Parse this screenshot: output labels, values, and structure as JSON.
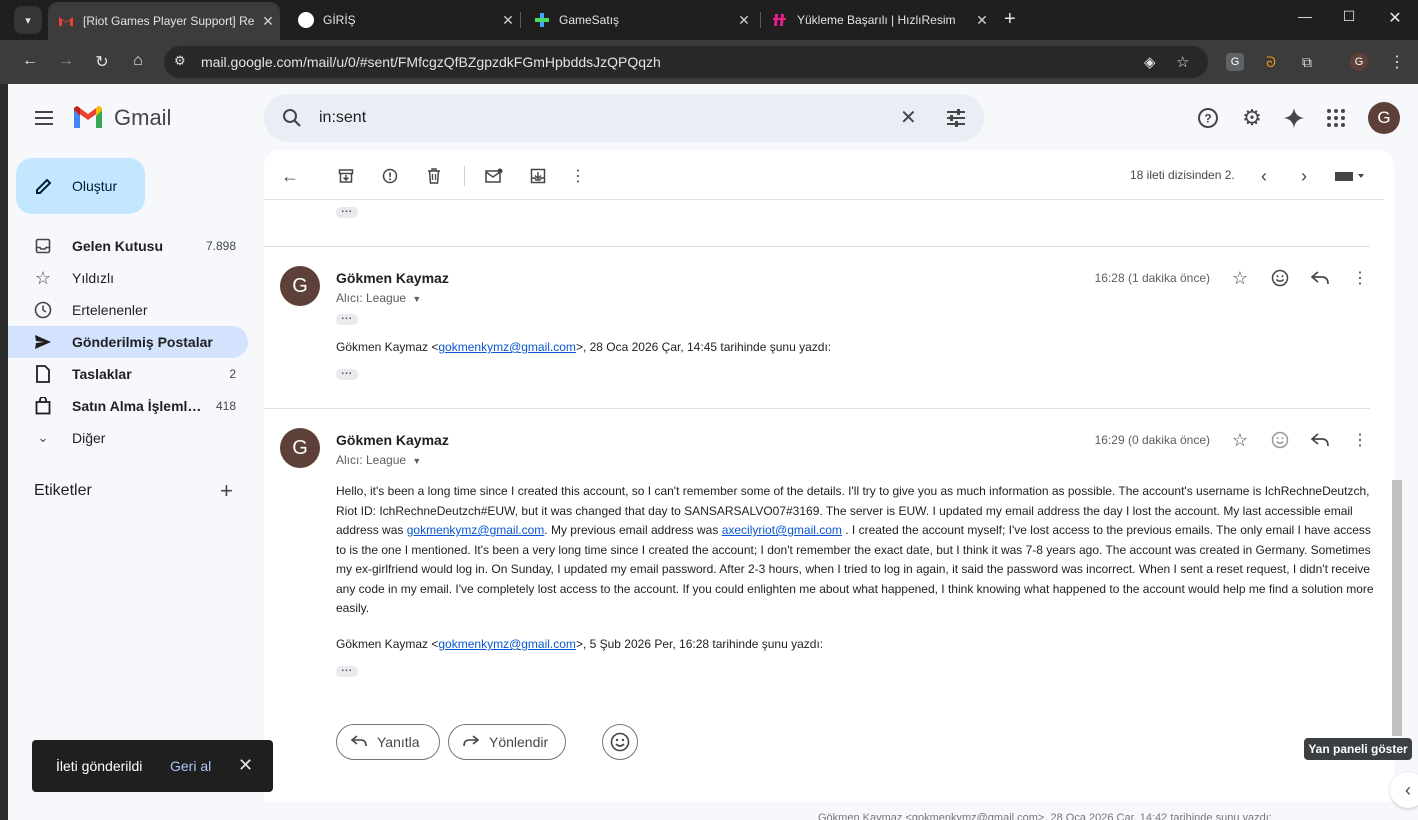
{
  "browser": {
    "tabs": [
      {
        "title": "[Riot Games Player Support] Re",
        "active": true
      },
      {
        "title": "GİRİŞ",
        "active": false
      },
      {
        "title": "GameSatış",
        "active": false
      },
      {
        "title": "Yükleme Başarılı | HızlıResim",
        "active": false
      }
    ],
    "url": "mail.google.com/mail/u/0/#sent/FMfcgzQfBZgpzdkFGmHpbddsJzQPQqzh"
  },
  "gmail": {
    "logo_text": "Gmail",
    "search_query": "in:sent",
    "avatar_letter": "G",
    "compose_label": "Oluştur",
    "nav": [
      {
        "label": "Gelen Kutusu",
        "count": "7.898",
        "icon": "inbox-icon"
      },
      {
        "label": "Yıldızlı",
        "count": "",
        "icon": "star-icon"
      },
      {
        "label": "Ertelenenler",
        "count": "",
        "icon": "clock-icon"
      },
      {
        "label": "Gönderilmiş Postalar",
        "count": "",
        "icon": "send-icon"
      },
      {
        "label": "Taslaklar",
        "count": "2",
        "icon": "draft-icon"
      },
      {
        "label": "Satın Alma İşlemleri",
        "count": "418",
        "icon": "bag-icon"
      },
      {
        "label": "Diğer",
        "count": "",
        "icon": "chevron-down-icon"
      }
    ],
    "labels_header": "Etiketler"
  },
  "toolbar": {
    "page_info": "18 ileti dizisinden 2."
  },
  "messages": [
    {
      "sender": "Gökmen Kaymaz",
      "to": "Alıcı: League",
      "time": "16:28 (1 dakika önce)",
      "quote_prefix": "Gökmen Kaymaz <",
      "quote_email": "gokmenkymz@gmail.com",
      "quote_suffix": ">, 28 Oca 2026 Çar, 14:45 tarihinde şunu yazdı:"
    },
    {
      "sender": "Gökmen Kaymaz",
      "to": "Alıcı: League",
      "time": "16:29 (0 dakika önce)",
      "body_1": "Hello, it's been a long time since I created this account, so I can't remember some of the details. I'll try to give you as much information as possible. The account's username is IchRechneDeutzch, Riot ID: IchRechneDeutzch#EUW, but it was changed that day to SANSARSALVO07#3169. The server is EUW. I updated my email address the day I lost the account. My last accessible email address was",
      "body_email_1": "gokmenkymz@gmail.com",
      "body_2": ".  My previous email address was",
      "body_email_2": "axecilyriot@gmail.com",
      "body_3": ". I created the account myself; I've lost access to the previous emails. The only email I have access to is the one I mentioned. It's been a very long time since I created the account; I don't remember the exact date, but I think it was 7-8 years ago. The account was created in Germany. Sometimes my ex-girlfriend would log in. On Sunday, I updated my email password. After 2-3 hours, when I tried to log in again, it said the password was incorrect. When I sent a reset request, I didn't receive any code in my email. I've completely lost access to the account. If you could enlighten me about what happened, I think knowing what happened to the account would help me find a solution more easily.",
      "quote_prefix": "Gökmen Kaymaz <",
      "quote_email": "gokmenkymz@gmail.com",
      "quote_suffix": ">, 5 Şub 2026 Per, 16:28 tarihinde şunu yazdı:"
    }
  ],
  "actions": {
    "reply_label": "Yanıtla",
    "forward_label": "Yönlendir"
  },
  "tooltip": "Yan paneli göster",
  "toast": {
    "message": "İleti gönderildi",
    "undo": "Geri al"
  },
  "behind_text": "Gökmen Kaymaz <gokmenkymz@gmail.com>, 28 Oca 2026 Çar, 14:42 tarihinde şunu yazdı:"
}
